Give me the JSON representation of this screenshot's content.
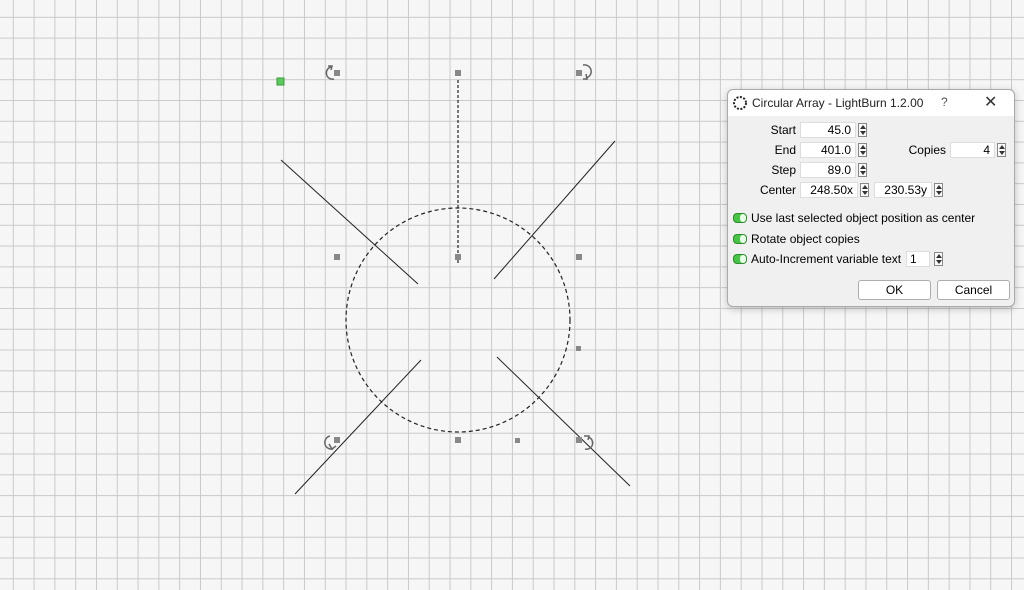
{
  "dialog": {
    "title": "Circular Array - LightBurn 1.2.00",
    "help_label": "?",
    "close_label": "✕",
    "start_label": "Start",
    "start_value": "45.0",
    "end_label": "End",
    "end_value": "401.0",
    "copies_label": "Copies",
    "copies_value": "4",
    "step_label": "Step",
    "step_value": "89.0",
    "center_label": "Center",
    "center_x": "248.50x",
    "center_y": "230.53y",
    "use_last_label": "Use last selected object position as center",
    "use_last_enabled": true,
    "rotate_label": "Rotate object copies",
    "rotate_enabled": true,
    "auto_increment_label": "Auto-Increment variable text",
    "auto_increment_enabled": true,
    "auto_increment_value": "1",
    "ok_label": "OK",
    "cancel_label": "Cancel"
  },
  "colors": {
    "grid_line": "#c9c9c9",
    "background": "#f6f6f6",
    "toggle_on": "#49c449",
    "handle": "#888888",
    "origin_marker": "#5ec95e"
  }
}
